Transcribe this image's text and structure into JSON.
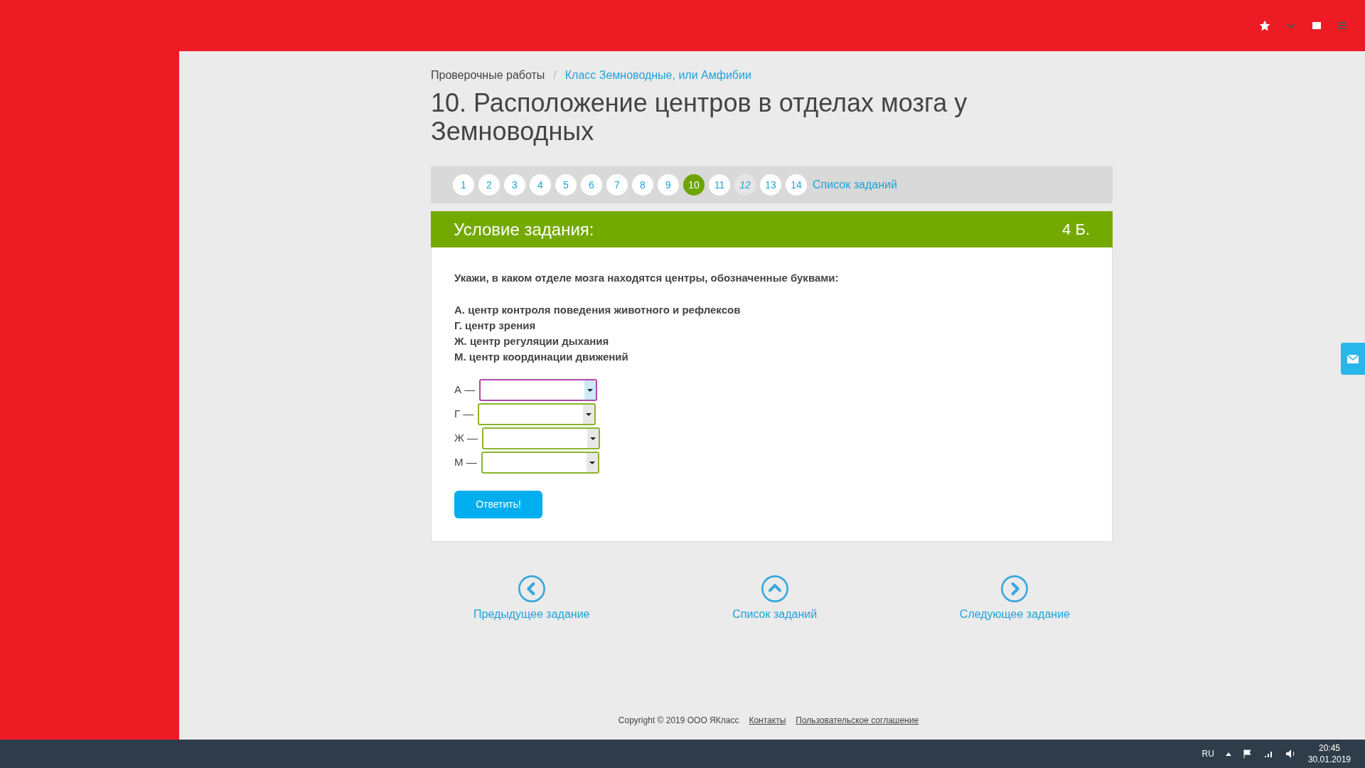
{
  "breadcrumb_separator": "/",
  "breadcrumb": [
    {
      "label": "Проверочные работы",
      "link": false
    },
    {
      "label": "Класс Земноводные, или Амфибии",
      "link": true
    }
  ],
  "title": "10. Расположение центров в отделах мозга у Земноводных",
  "pager": {
    "items": [
      {
        "label": "1",
        "selected": false,
        "skipped": false
      },
      {
        "label": "2",
        "selected": false,
        "skipped": false
      },
      {
        "label": "3",
        "selected": false,
        "skipped": false
      },
      {
        "label": "4",
        "selected": false,
        "skipped": false
      },
      {
        "label": "5",
        "selected": false,
        "skipped": false
      },
      {
        "label": "6",
        "selected": false,
        "skipped": false
      },
      {
        "label": "7",
        "selected": false,
        "skipped": false
      },
      {
        "label": "8",
        "selected": false,
        "skipped": false
      },
      {
        "label": "9",
        "selected": false,
        "skipped": false
      },
      {
        "label": "10",
        "selected": true,
        "skipped": false
      },
      {
        "label": "11",
        "selected": false,
        "skipped": false
      },
      {
        "label": "12",
        "selected": false,
        "skipped": true
      },
      {
        "label": "13",
        "selected": false,
        "skipped": false
      },
      {
        "label": "14",
        "selected": false,
        "skipped": false
      }
    ],
    "list_link": "Список заданий"
  },
  "task": {
    "header": "Условие задания:",
    "points": "4 Б.",
    "question": "Укажи, в каком отделе мозга находятся центры, обозначенные буквами:",
    "lines": [
      "А. центр контроля поведения животного и рефлексов",
      "Г. центр зрения",
      "Ж. центр регуляции дыхания",
      "М. центр координации движений"
    ],
    "answers": [
      {
        "label": "А —",
        "focused": true
      },
      {
        "label": "Г —",
        "focused": false
      },
      {
        "label": "Ж —",
        "focused": false
      },
      {
        "label": "М —",
        "focused": false
      }
    ],
    "submit": "Ответить!"
  },
  "navigation": [
    {
      "kind": "prev",
      "label": "Предыдущее задание"
    },
    {
      "kind": "up",
      "label": "Список заданий"
    },
    {
      "kind": "next",
      "label": "Следующее задание"
    }
  ],
  "footer": {
    "copyright": "Copyright © 2019 ООО ЯКласс",
    "links": [
      "Контакты",
      "Пользовательское соглашение"
    ]
  },
  "taskbar": {
    "language": "RU",
    "time": "20:45",
    "date": "30.01.2019"
  }
}
